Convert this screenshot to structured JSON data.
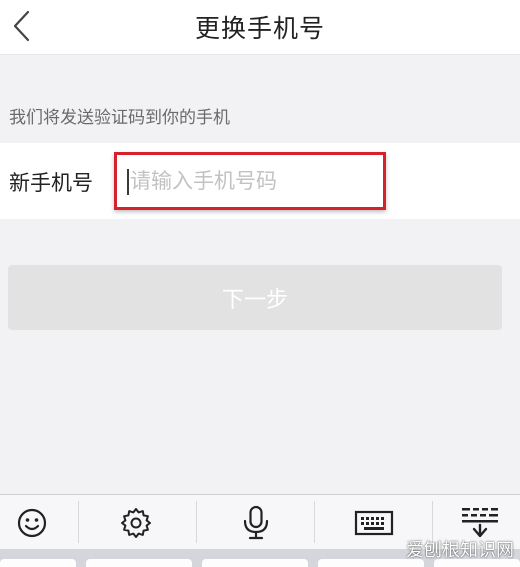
{
  "nav": {
    "title": "更换手机号",
    "back_icon": "chevron-left-icon"
  },
  "hint": "我们将发送验证码到你的手机",
  "phone": {
    "label": "新手机号",
    "placeholder": "请输入手机号码",
    "value": ""
  },
  "next_button": "下一步",
  "keyboard_toolbar": {
    "icons": [
      "emoji-icon",
      "gear-icon",
      "microphone-icon",
      "keyboard-icon",
      "collapse-keyboard-icon"
    ]
  },
  "watermark": "爱刨根知识网",
  "colors": {
    "highlight": "#d6202a",
    "button_disabled": "#e2e2e2",
    "background": "#f2f2f5"
  }
}
